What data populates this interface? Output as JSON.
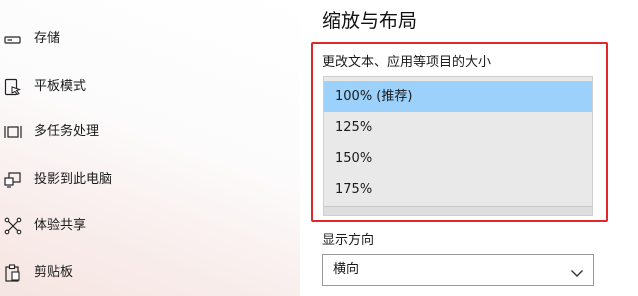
{
  "sidebar": {
    "items": [
      {
        "label": "存储",
        "icon": "storage-icon"
      },
      {
        "label": "平板模式",
        "icon": "tablet-mode-icon"
      },
      {
        "label": "多任务处理",
        "icon": "multitasking-icon"
      },
      {
        "label": "投影到此电脑",
        "icon": "project-to-pc-icon"
      },
      {
        "label": "体验共享",
        "icon": "shared-experiences-icon"
      },
      {
        "label": "剪贴板",
        "icon": "clipboard-icon"
      }
    ]
  },
  "main": {
    "section_title": "缩放与布局",
    "scale": {
      "label": "更改文本、应用等项目的大小",
      "options": [
        "100% (推荐)",
        "125%",
        "150%",
        "175%"
      ],
      "selected": "100% (推荐)"
    },
    "orientation": {
      "label": "显示方向",
      "value": "横向",
      "icon": "chevron-down-icon"
    }
  },
  "colors": {
    "selection": "#9bd1fa",
    "highlight_border": "#e0282a",
    "dropdown_bg": "#e9e9e9"
  }
}
